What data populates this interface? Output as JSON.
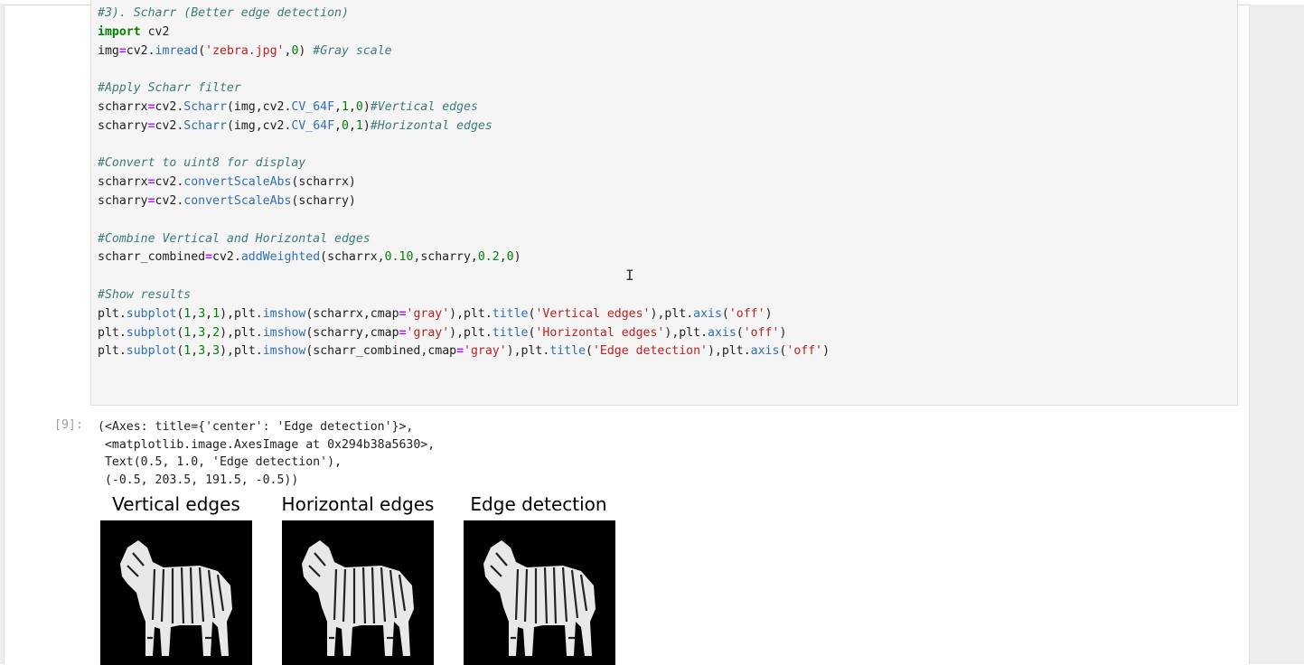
{
  "notebook": {
    "code_lines": [
      [
        {
          "t": "#3). Scharr (Better edge detection)",
          "c": "cm"
        }
      ],
      [
        {
          "t": "import",
          "c": "kw"
        },
        {
          "t": " cv2"
        }
      ],
      [
        {
          "t": "img"
        },
        {
          "t": "=",
          "c": "op"
        },
        {
          "t": "cv2."
        },
        {
          "t": "imread",
          "c": "fn"
        },
        {
          "t": "("
        },
        {
          "t": "'zebra.jpg'",
          "c": "st"
        },
        {
          "t": ","
        },
        {
          "t": "0",
          "c": "nm"
        },
        {
          "t": ") "
        },
        {
          "t": "#Gray scale",
          "c": "cm"
        }
      ],
      [],
      [
        {
          "t": "#Apply Scharr filter",
          "c": "cm"
        }
      ],
      [
        {
          "t": "scharrx"
        },
        {
          "t": "=",
          "c": "op"
        },
        {
          "t": "cv2."
        },
        {
          "t": "Scharr",
          "c": "fn"
        },
        {
          "t": "(img,cv2."
        },
        {
          "t": "CV_64F",
          "c": "fn"
        },
        {
          "t": ","
        },
        {
          "t": "1",
          "c": "nm"
        },
        {
          "t": ","
        },
        {
          "t": "0",
          "c": "nm"
        },
        {
          "t": ")"
        },
        {
          "t": "#Vertical edges",
          "c": "cm"
        }
      ],
      [
        {
          "t": "scharry"
        },
        {
          "t": "=",
          "c": "op"
        },
        {
          "t": "cv2."
        },
        {
          "t": "Scharr",
          "c": "fn"
        },
        {
          "t": "(img,cv2."
        },
        {
          "t": "CV_64F",
          "c": "fn"
        },
        {
          "t": ","
        },
        {
          "t": "0",
          "c": "nm"
        },
        {
          "t": ","
        },
        {
          "t": "1",
          "c": "nm"
        },
        {
          "t": ")"
        },
        {
          "t": "#Horizontal edges",
          "c": "cm"
        }
      ],
      [],
      [
        {
          "t": "#Convert to uint8 for display",
          "c": "cm"
        }
      ],
      [
        {
          "t": "scharrx"
        },
        {
          "t": "=",
          "c": "op"
        },
        {
          "t": "cv2."
        },
        {
          "t": "convertScaleAbs",
          "c": "fn"
        },
        {
          "t": "(scharrx)"
        }
      ],
      [
        {
          "t": "scharry"
        },
        {
          "t": "=",
          "c": "op"
        },
        {
          "t": "cv2."
        },
        {
          "t": "convertScaleAbs",
          "c": "fn"
        },
        {
          "t": "(scharry)"
        }
      ],
      [],
      [
        {
          "t": "#Combine Vertical and Horizontal edges",
          "c": "cm"
        }
      ],
      [
        {
          "t": "scharr_combined"
        },
        {
          "t": "=",
          "c": "op"
        },
        {
          "t": "cv2."
        },
        {
          "t": "addWeighted",
          "c": "fn"
        },
        {
          "t": "(scharrx,"
        },
        {
          "t": "0.10",
          "c": "nm"
        },
        {
          "t": ",scharry,"
        },
        {
          "t": "0.2",
          "c": "nm"
        },
        {
          "t": ","
        },
        {
          "t": "0",
          "c": "nm"
        },
        {
          "t": ")"
        }
      ],
      [],
      [
        {
          "t": "#Show results",
          "c": "cm"
        }
      ],
      [
        {
          "t": "plt."
        },
        {
          "t": "subplot",
          "c": "fn"
        },
        {
          "t": "("
        },
        {
          "t": "1",
          "c": "nm"
        },
        {
          "t": ","
        },
        {
          "t": "3",
          "c": "nm"
        },
        {
          "t": ","
        },
        {
          "t": "1",
          "c": "nm"
        },
        {
          "t": "),plt."
        },
        {
          "t": "imshow",
          "c": "fn"
        },
        {
          "t": "(scharrx,cmap"
        },
        {
          "t": "=",
          "c": "op"
        },
        {
          "t": "'gray'",
          "c": "st"
        },
        {
          "t": "),plt."
        },
        {
          "t": "title",
          "c": "fn"
        },
        {
          "t": "("
        },
        {
          "t": "'Vertical edges'",
          "c": "st"
        },
        {
          "t": "),plt."
        },
        {
          "t": "axis",
          "c": "fn"
        },
        {
          "t": "("
        },
        {
          "t": "'off'",
          "c": "st"
        },
        {
          "t": ")"
        }
      ],
      [
        {
          "t": "plt."
        },
        {
          "t": "subplot",
          "c": "fn"
        },
        {
          "t": "("
        },
        {
          "t": "1",
          "c": "nm"
        },
        {
          "t": ","
        },
        {
          "t": "3",
          "c": "nm"
        },
        {
          "t": ","
        },
        {
          "t": "2",
          "c": "nm"
        },
        {
          "t": "),plt."
        },
        {
          "t": "imshow",
          "c": "fn"
        },
        {
          "t": "(scharry,cmap"
        },
        {
          "t": "=",
          "c": "op"
        },
        {
          "t": "'gray'",
          "c": "st"
        },
        {
          "t": "),plt."
        },
        {
          "t": "title",
          "c": "fn"
        },
        {
          "t": "("
        },
        {
          "t": "'Horizontal edges'",
          "c": "st"
        },
        {
          "t": "),plt."
        },
        {
          "t": "axis",
          "c": "fn"
        },
        {
          "t": "("
        },
        {
          "t": "'off'",
          "c": "st"
        },
        {
          "t": ")"
        }
      ],
      [
        {
          "t": "plt."
        },
        {
          "t": "subplot",
          "c": "fn"
        },
        {
          "t": "("
        },
        {
          "t": "1",
          "c": "nm"
        },
        {
          "t": ","
        },
        {
          "t": "3",
          "c": "nm"
        },
        {
          "t": ","
        },
        {
          "t": "3",
          "c": "nm"
        },
        {
          "t": "),plt."
        },
        {
          "t": "imshow",
          "c": "fn"
        },
        {
          "t": "(scharr_combined,cmap"
        },
        {
          "t": "=",
          "c": "op"
        },
        {
          "t": "'gray'",
          "c": "st"
        },
        {
          "t": "),plt."
        },
        {
          "t": "title",
          "c": "fn"
        },
        {
          "t": "("
        },
        {
          "t": "'Edge detection'",
          "c": "st"
        },
        {
          "t": "),plt."
        },
        {
          "t": "axis",
          "c": "fn"
        },
        {
          "t": "("
        },
        {
          "t": "'off'",
          "c": "st"
        },
        {
          "t": ")"
        }
      ]
    ],
    "output_prompt": "[9]:",
    "output_lines": [
      "(<Axes: title={'center': 'Edge detection'}>,",
      " <matplotlib.image.AxesImage at 0x294b38a5630>,",
      " Text(0.5, 1.0, 'Edge detection'),",
      " (-0.5, 203.5, 191.5, -0.5))"
    ],
    "plots": [
      {
        "title": "Vertical edges",
        "icon": "zebra-edge-image"
      },
      {
        "title": "Horizontal edges",
        "icon": "zebra-edge-image"
      },
      {
        "title": "Edge detection",
        "icon": "zebra-edge-image"
      }
    ],
    "colors": {
      "code_bg": "#f5f5f5",
      "comment": "#3d7a7a",
      "keyword": "#008000",
      "string": "#ba2121",
      "function": "#2f6fb3",
      "operator": "#aa22ff"
    }
  }
}
